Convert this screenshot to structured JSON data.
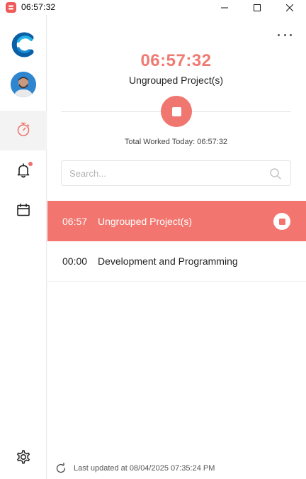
{
  "window": {
    "title": "06:57:32",
    "controls": [
      "minimize",
      "maximize",
      "close"
    ]
  },
  "sidebar": {
    "logo": "c-logo",
    "avatar": "user-avatar",
    "items": [
      {
        "id": "timer",
        "icon": "stopwatch-icon",
        "active": true
      },
      {
        "id": "notifications",
        "icon": "bell-icon",
        "has_badge": true
      },
      {
        "id": "calendar",
        "icon": "calendar-icon"
      }
    ],
    "settings_icon": "gear-icon"
  },
  "timer": {
    "elapsed": "06:57:32",
    "project": "Ungrouped Project(s)",
    "total_worked": "Total Worked Today: 06:57:32"
  },
  "search": {
    "placeholder": "Search...",
    "value": ""
  },
  "projects": [
    {
      "time": "06:57",
      "name": "Ungrouped Project(s)",
      "active": true
    },
    {
      "time": "00:00",
      "name": "Development and Programming",
      "active": false
    }
  ],
  "footer": {
    "last_updated": "Last updated at 08/04/2025 07:35:24 PM"
  },
  "colors": {
    "accent": "#f2766f",
    "timer_text": "#ef7a72",
    "badge": "#f16c6c"
  }
}
